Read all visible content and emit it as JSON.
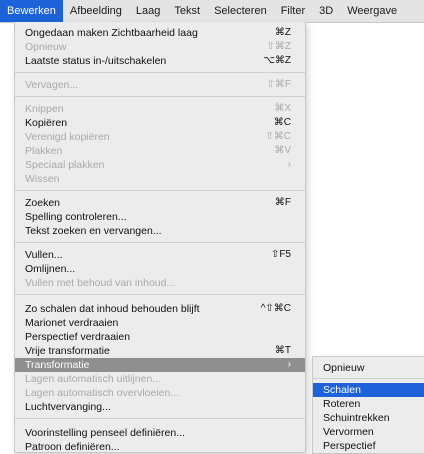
{
  "menubar": {
    "items": [
      "Bewerken",
      "Afbeelding",
      "Laag",
      "Tekst",
      "Selecteren",
      "Filter",
      "3D",
      "Weergave"
    ],
    "active": "Bewerken"
  },
  "menu": {
    "items": [
      {
        "label": "Ongedaan maken Zichtbaarheid laag",
        "shortcut": "⌘Z",
        "state": "enabled"
      },
      {
        "label": "Opnieuw",
        "shortcut": "⇧⌘Z",
        "state": "disabled"
      },
      {
        "label": "Laatste status in-/uitschakelen",
        "shortcut": "⌥⌘Z",
        "state": "enabled"
      },
      {
        "label": "Vervagen...",
        "shortcut": "⇧⌘F",
        "state": "disabled"
      },
      {
        "label": "Knippen",
        "shortcut": "⌘X",
        "state": "disabled"
      },
      {
        "label": "Kopiëren",
        "shortcut": "⌘C",
        "state": "enabled"
      },
      {
        "label": "Verenigd kopiëren",
        "shortcut": "⇧⌘C",
        "state": "disabled"
      },
      {
        "label": "Plakken",
        "shortcut": "⌘V",
        "state": "disabled"
      },
      {
        "label": "Speciaal plakken",
        "shortcut": "›",
        "state": "disabled"
      },
      {
        "label": "Wissen",
        "shortcut": "",
        "state": "disabled"
      },
      {
        "label": "Zoeken",
        "shortcut": "⌘F",
        "state": "enabled"
      },
      {
        "label": "Spelling controleren...",
        "shortcut": "",
        "state": "enabled"
      },
      {
        "label": "Tekst zoeken en vervangen...",
        "shortcut": "",
        "state": "enabled"
      },
      {
        "label": "Vullen...",
        "shortcut": "⇧F5",
        "state": "enabled"
      },
      {
        "label": "Omlijnen...",
        "shortcut": "",
        "state": "enabled"
      },
      {
        "label": "Vullen met behoud van inhoud...",
        "shortcut": "",
        "state": "disabled"
      },
      {
        "label": "Zo schalen dat inhoud behouden blijft",
        "shortcut": "^⇧⌘C",
        "state": "enabled"
      },
      {
        "label": "Marionet verdraaien",
        "shortcut": "",
        "state": "enabled"
      },
      {
        "label": "Perspectief verdraaien",
        "shortcut": "",
        "state": "enabled"
      },
      {
        "label": "Vrije transformatie",
        "shortcut": "⌘T",
        "state": "enabled"
      },
      {
        "label": "Transformatie",
        "shortcut": "›",
        "state": "highlight"
      },
      {
        "label": "Lagen automatisch uitlijnen...",
        "shortcut": "",
        "state": "disabled"
      },
      {
        "label": "Lagen automatisch overvloeien...",
        "shortcut": "",
        "state": "disabled"
      },
      {
        "label": "Luchtvervanging...",
        "shortcut": "",
        "state": "enabled"
      },
      {
        "label": "Voorinstelling penseel definiëren...",
        "shortcut": "",
        "state": "enabled"
      },
      {
        "label": "Patroon definiëren...",
        "shortcut": "",
        "state": "enabled"
      }
    ]
  },
  "submenu": {
    "items": [
      {
        "label": "Opnieuw",
        "state": "normal"
      },
      {
        "label": "Schalen",
        "state": "selected"
      },
      {
        "label": "Roteren",
        "state": "normal"
      },
      {
        "label": "Schuintrekken",
        "state": "normal"
      },
      {
        "label": "Vervormen",
        "state": "normal"
      },
      {
        "label": "Perspectief",
        "state": "normal"
      }
    ]
  },
  "colors": {
    "selection": "#1d62d8",
    "highlight": "#8f8f8f",
    "menu_bg": "#ececec",
    "disabled_text": "#a9a9a9"
  }
}
